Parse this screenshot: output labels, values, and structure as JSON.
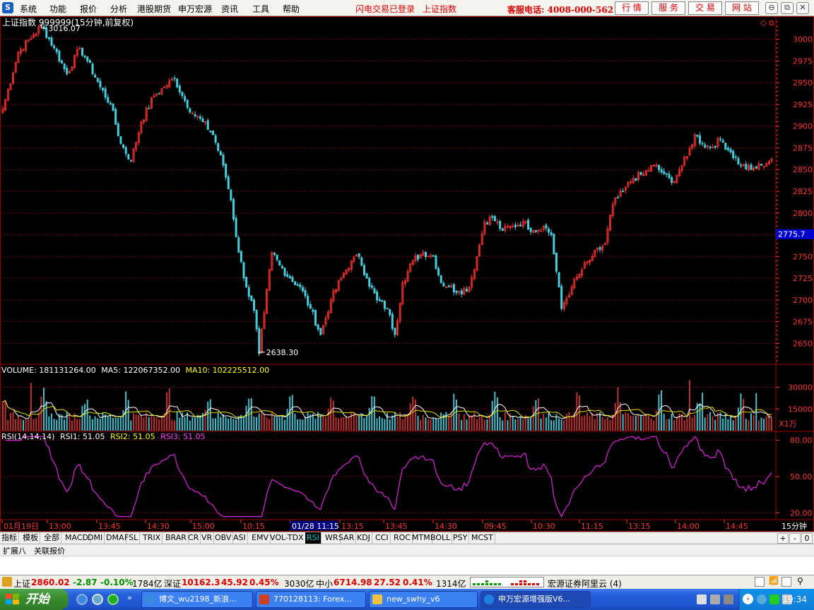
{
  "menu": {
    "items": [
      "系统",
      "功能",
      "报价",
      "分析",
      "港股期货",
      "申万宏源",
      "资讯",
      "工具",
      "帮助"
    ],
    "login_status": "闪电交易已登录",
    "current_index": "上证指数",
    "hotline": "客服电话: 4008-000-562",
    "right_buttons": [
      "行 情",
      "服 务",
      "交 易",
      "网 站"
    ]
  },
  "chart_header": {
    "title": "上证指数 999999(15分钟,前复权)",
    "high_label": "3016.07",
    "low_label": "2638.30",
    "current_price_tag": "2775.7"
  },
  "volume_header": {
    "label": "VOLUME: 181131264.00",
    "ma5": "MA5: 122067352.00",
    "ma10": "MA10: 102225512.00",
    "unit": "X1万"
  },
  "rsi_header": {
    "label": "RSI(14,14,14)",
    "rsi1": "RSI1: 51.05",
    "rsi2": "RSI2: 51.05",
    "rsi3": "RSI3: 51.05"
  },
  "time_axis": {
    "labels": [
      "01月19日",
      "13:00",
      "13:45",
      "14:30",
      "15:00",
      "10:15",
      "01/28 11:15",
      "13:15",
      "13:45",
      "14:30",
      "09:45",
      "10:30",
      "11:15",
      "13:15",
      "14:00",
      "14:45"
    ],
    "period": "15分钟"
  },
  "tabs": {
    "items": [
      "指标",
      "模板",
      "全部",
      "MACD",
      "DMI",
      "DMA",
      "FSL",
      "TRIX",
      "BRAR",
      "CR",
      "VR",
      "OBV",
      "ASI",
      "EMV",
      "VOL-TDX",
      "RSI",
      "WR",
      "SAR",
      "KDJ",
      "CCI",
      "ROC",
      "MTM",
      "BOLL",
      "PSY",
      "MCST"
    ],
    "active": "RSI",
    "nav": [
      "+",
      "-",
      "0"
    ]
  },
  "ext": {
    "expand": "扩展八",
    "related": "关联报价"
  },
  "statusbar": {
    "sh_name": "上证",
    "sh_price": "2860.02",
    "sh_chg": "-2.87",
    "sh_pct": "-0.10%",
    "sh_amt": "1784亿",
    "sz_name": "深证",
    "sz_price": "10162.3",
    "sz_chg": "45.92",
    "sz_pct": "0.45%",
    "sz_amt": "3030亿",
    "zx_name": "中小",
    "zx_price": "6714.98",
    "zx_chg": "27.52",
    "zx_pct": "0.41%",
    "zx_amt": "1314亿",
    "broker": "宏源证券阿里云 (4)"
  },
  "taskbar": {
    "start": "开始",
    "tasks": [
      "博文_wu2198_新浪...",
      "770128113: Forex...",
      "new_swhy_v6",
      "申万宏源增强版V6..."
    ],
    "clock": "19:34"
  },
  "colors": {
    "up": "#ff3030",
    "down": "#40d0e0",
    "grid": "#800000",
    "ma5": "#ffffff",
    "ma10": "#e0e000",
    "rsi": "#e020e0",
    "axis_label": "#ff3030",
    "price_tag_bg": "#0000d0"
  },
  "chart_data": [
    {
      "type": "candlestick",
      "title": "上证指数 999999(15分钟,前复权)",
      "ylim": [
        2630,
        3020
      ],
      "yticks": [
        2650,
        2675,
        2700,
        2725,
        2750,
        2775,
        2800,
        2825,
        2850,
        2875,
        2900,
        2925,
        2950,
        2975,
        3000
      ],
      "keypoints": [
        [
          0,
          2920
        ],
        [
          6,
          2985
        ],
        [
          12,
          3005
        ],
        [
          15,
          3016.07
        ],
        [
          20,
          2990
        ],
        [
          25,
          2960
        ],
        [
          30,
          2990
        ],
        [
          33,
          2975
        ],
        [
          38,
          2945
        ],
        [
          42,
          2925
        ],
        [
          46,
          2880
        ],
        [
          50,
          2860
        ],
        [
          54,
          2905
        ],
        [
          59,
          2935
        ],
        [
          63,
          2945
        ],
        [
          67,
          2955
        ],
        [
          70,
          2935
        ],
        [
          74,
          2915
        ],
        [
          78,
          2905
        ],
        [
          82,
          2890
        ],
        [
          86,
          2855
        ],
        [
          89,
          2815
        ],
        [
          92,
          2755
        ],
        [
          95,
          2715
        ],
        [
          98,
          2688
        ],
        [
          100,
          2638.3
        ],
        [
          102,
          2685
        ],
        [
          105,
          2755
        ],
        [
          108,
          2740
        ],
        [
          112,
          2725
        ],
        [
          116,
          2715
        ],
        [
          120,
          2690
        ],
        [
          124,
          2660
        ],
        [
          128,
          2700
        ],
        [
          132,
          2725
        ],
        [
          136,
          2745
        ],
        [
          139,
          2750
        ],
        [
          142,
          2725
        ],
        [
          146,
          2700
        ],
        [
          150,
          2690
        ],
        [
          153,
          2660
        ],
        [
          156,
          2720
        ],
        [
          160,
          2745
        ],
        [
          164,
          2755
        ],
        [
          168,
          2750
        ],
        [
          171,
          2720
        ],
        [
          174,
          2715
        ],
        [
          178,
          2710
        ],
        [
          182,
          2715
        ],
        [
          185,
          2750
        ],
        [
          188,
          2790
        ],
        [
          191,
          2795
        ],
        [
          195,
          2780
        ],
        [
          199,
          2785
        ],
        [
          203,
          2790
        ],
        [
          207,
          2780
        ],
        [
          211,
          2785
        ],
        [
          214,
          2775
        ],
        [
          218,
          2690
        ],
        [
          222,
          2715
        ],
        [
          226,
          2735
        ],
        [
          230,
          2750
        ],
        [
          235,
          2765
        ],
        [
          238,
          2810
        ],
        [
          242,
          2825
        ],
        [
          246,
          2840
        ],
        [
          250,
          2845
        ],
        [
          254,
          2855
        ],
        [
          258,
          2845
        ],
        [
          261,
          2835
        ],
        [
          264,
          2850
        ],
        [
          267,
          2865
        ],
        [
          270,
          2890
        ],
        [
          273,
          2880
        ],
        [
          276,
          2875
        ],
        [
          280,
          2885
        ],
        [
          284,
          2870
        ],
        [
          288,
          2855
        ],
        [
          292,
          2850
        ],
        [
          296,
          2855
        ],
        [
          300,
          2862
        ]
      ],
      "n_bars": 301
    },
    {
      "type": "bar",
      "name": "VOLUME",
      "ylim": [
        0,
        40000
      ],
      "yticks": [
        15000,
        30000
      ],
      "ma": [
        "MA5",
        "MA10"
      ]
    },
    {
      "type": "line",
      "name": "RSI",
      "ylim": [
        15,
        85
      ],
      "yticks": [
        20,
        50,
        80
      ]
    }
  ]
}
